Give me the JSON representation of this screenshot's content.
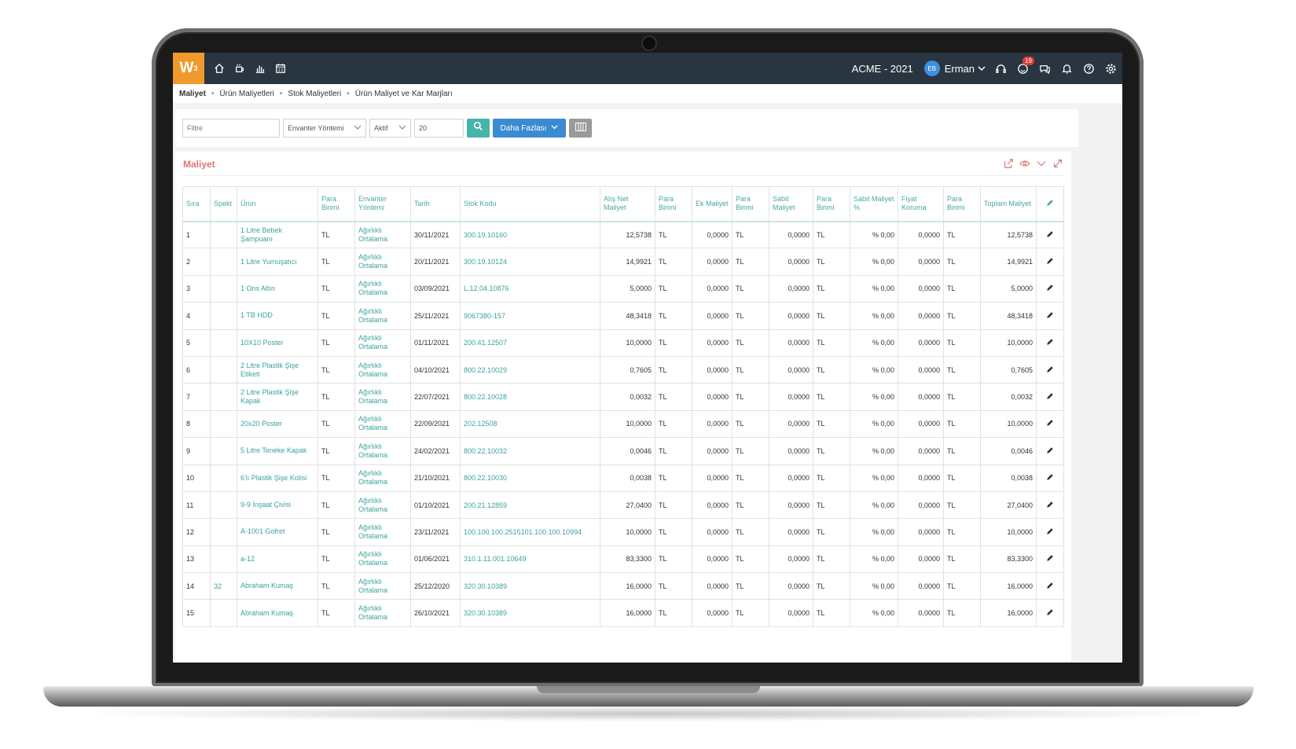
{
  "topbar": {
    "logo": "W",
    "logo_sup": "3",
    "company": "ACME - 2021",
    "user_initials": "EB",
    "user_name": "Erman",
    "notification_count": "19"
  },
  "breadcrumb": {
    "items": [
      "Maliyet",
      "Ürün Maliyetleri",
      "Stok Maliyetleri",
      "Ürün Maliyet ve Kar Marjları"
    ]
  },
  "filters": {
    "filter_placeholder": "Filtre",
    "inventory_method": "Envanter Yöntemi",
    "status": "Aktif",
    "page_size": "20",
    "more_label": "Daha Fazlası"
  },
  "panel": {
    "title": "Maliyet"
  },
  "table": {
    "headers": [
      "Sıra",
      "Spekt",
      "Ürün",
      "Para Birimi",
      "Envanter Yöntemi",
      "Tarih",
      "Stok Kodu",
      "Alış Net Maliyet",
      "Para Birimi",
      "Ek Maliyet",
      "Para Birimi",
      "Sabit Maliyet",
      "Para Birimi",
      "Sabit Maliyet %",
      "Fiyat Koruma",
      "Para Birimi",
      "Toplam Maliyet"
    ],
    "rows": [
      [
        "1",
        "",
        "1 Litre Bebek Şampuanı",
        "TL",
        "Ağırlıklı Ortalama",
        "30/11/2021",
        "300.19.10160",
        "12,5738",
        "TL",
        "0,0000",
        "TL",
        "0,0000",
        "TL",
        "% 0,00",
        "0,0000",
        "TL",
        "12,5738"
      ],
      [
        "2",
        "",
        "1 Litre Yumuşatıcı",
        "TL",
        "Ağırlıklı Ortalama",
        "20/11/2021",
        "300.19.10124",
        "14,9921",
        "TL",
        "0,0000",
        "TL",
        "0,0000",
        "TL",
        "% 0,00",
        "0,0000",
        "TL",
        "14,9921"
      ],
      [
        "3",
        "",
        "1 Ons Altın",
        "TL",
        "Ağırlıklı Ortalama",
        "03/09/2021",
        "L.12.04.10876",
        "5,0000",
        "TL",
        "0,0000",
        "TL",
        "0,0000",
        "TL",
        "% 0,00",
        "0,0000",
        "TL",
        "5,0000"
      ],
      [
        "4",
        "",
        "1 TB HDD",
        "TL",
        "Ağırlıklı Ortalama",
        "25/11/2021",
        "9067380-157",
        "48,3418",
        "TL",
        "0,0000",
        "TL",
        "0,0000",
        "TL",
        "% 0,00",
        "0,0000",
        "TL",
        "48,3418"
      ],
      [
        "5",
        "",
        "10X10 Poster",
        "TL",
        "Ağırlıklı Ortalama",
        "01/11/2021",
        "200.41.12507",
        "10,0000",
        "TL",
        "0,0000",
        "TL",
        "0,0000",
        "TL",
        "% 0,00",
        "0,0000",
        "TL",
        "10,0000"
      ],
      [
        "6",
        "",
        "2 Litre Plastik Şişe Etiketi",
        "TL",
        "Ağırlıklı Ortalama",
        "04/10/2021",
        "800.22.10029",
        "0,7605",
        "TL",
        "0,0000",
        "TL",
        "0,0000",
        "TL",
        "% 0,00",
        "0,0000",
        "TL",
        "0,7605"
      ],
      [
        "7",
        "",
        "2 Litre Plastik Şişe Kapak",
        "TL",
        "Ağırlıklı Ortalama",
        "22/07/2021",
        "800.22.10028",
        "0,0032",
        "TL",
        "0,0000",
        "TL",
        "0,0000",
        "TL",
        "% 0,00",
        "0,0000",
        "TL",
        "0,0032"
      ],
      [
        "8",
        "",
        "20x20 Poster",
        "TL",
        "Ağırlıklı Ortalama",
        "22/09/2021",
        "202.12508",
        "10,0000",
        "TL",
        "0,0000",
        "TL",
        "0,0000",
        "TL",
        "% 0,00",
        "0,0000",
        "TL",
        "10,0000"
      ],
      [
        "9",
        "",
        "5 Litre Teneke Kapak",
        "TL",
        "Ağırlıklı Ortalama",
        "24/02/2021",
        "800.22.10032",
        "0,0046",
        "TL",
        "0,0000",
        "TL",
        "0,0000",
        "TL",
        "% 0,00",
        "0,0000",
        "TL",
        "0,0046"
      ],
      [
        "10",
        "",
        "6'lı Plastik Şişe Kolisi",
        "TL",
        "Ağırlıklı Ortalama",
        "21/10/2021",
        "800.22.10030",
        "0,0038",
        "TL",
        "0,0000",
        "TL",
        "0,0000",
        "TL",
        "% 0,00",
        "0,0000",
        "TL",
        "0,0038"
      ],
      [
        "11",
        "",
        "9-9 İnşaat Çivisi",
        "TL",
        "Ağırlıklı Ortalama",
        "01/10/2021",
        "200.21.12859",
        "27,0400",
        "TL",
        "0,0000",
        "TL",
        "0,0000",
        "TL",
        "% 0,00",
        "0,0000",
        "TL",
        "27,0400"
      ],
      [
        "12",
        "",
        "A-1001 Gofret",
        "TL",
        "Ağırlıklı Ortalama",
        "23/11/2021",
        "100.100.100.2515101.100.100.10994",
        "10,0000",
        "TL",
        "0,0000",
        "TL",
        "0,0000",
        "TL",
        "% 0,00",
        "0,0000",
        "TL",
        "10,0000"
      ],
      [
        "13",
        "",
        "a-12",
        "TL",
        "Ağırlıklı Ortalama",
        "01/06/2021",
        "310.1.11.001.10649",
        "83,3300",
        "TL",
        "0,0000",
        "TL",
        "0,0000",
        "TL",
        "% 0,00",
        "0,0000",
        "TL",
        "83,3300"
      ],
      [
        "14",
        "32",
        "Abraham Kumaş",
        "TL",
        "Ağırlıklı Ortalama",
        "25/12/2020",
        "320.30.10389",
        "16,0000",
        "TL",
        "0,0000",
        "TL",
        "0,0000",
        "TL",
        "% 0,00",
        "0,0000",
        "TL",
        "16,0000"
      ],
      [
        "15",
        "",
        "Abraham Kumaş",
        "TL",
        "Ağırlıklı Ortalama",
        "26/10/2021",
        "320.30.10389",
        "16,0000",
        "TL",
        "0,0000",
        "TL",
        "0,0000",
        "TL",
        "% 0,00",
        "0,0000",
        "TL",
        "16,0000"
      ]
    ]
  },
  "colors": {
    "accent_teal": "#45b5aa",
    "brand_orange": "#f09a2b",
    "topbar": "#293540",
    "primary_blue": "#3b8bd2",
    "title_red": "#e07474"
  }
}
